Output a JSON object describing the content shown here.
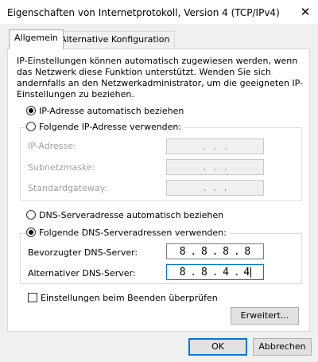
{
  "window": {
    "title": "Eigenschaften von Internetprotokoll, Version 4 (TCP/IPv4)",
    "close_glyph": "✕"
  },
  "tabs": [
    {
      "label": "Allgemein",
      "active": true
    },
    {
      "label": "Alternative Konfiguration",
      "active": false
    }
  ],
  "description": "IP-Einstellungen können automatisch zugewiesen werden, wenn das Netzwerk diese Funktion unterstützt. Wenden Sie sich andernfalls an den Netzwerkadministrator, um die geeigneten IP-Einstellungen zu beziehen.",
  "ip_section": {
    "auto_radio": {
      "text": "IP-Adresse automatisch beziehen",
      "selected": true
    },
    "manual_radio": {
      "text": "Folgende IP-Adresse verwenden:",
      "selected": false
    },
    "fields": [
      {
        "label": "IP-Adresse:",
        "value": ". . ."
      },
      {
        "label": "Subnetzmaske:",
        "value": ". . ."
      },
      {
        "label": "Standardgateway:",
        "value": ". . ."
      }
    ]
  },
  "dns_section": {
    "auto_radio": {
      "text": "DNS-Serveradresse automatisch beziehen",
      "selected": false
    },
    "manual_radio": {
      "text": "Folgende DNS-Serveradressen verwenden:",
      "selected": true
    },
    "preferred": {
      "label": "Bevorzugter DNS-Server:",
      "octets": [
        "8",
        "8",
        "8",
        "8"
      ]
    },
    "alternate": {
      "label": "Alternativer DNS-Server:",
      "octets": [
        "8",
        "8",
        "4",
        "4"
      ]
    }
  },
  "validate_checkbox": {
    "text": "Einstellungen beim Beenden überprüfen",
    "checked": false
  },
  "buttons": {
    "advanced": "Erweitert...",
    "ok": "OK",
    "cancel": "Abbrechen"
  },
  "colors": {
    "accent": "#0078d7",
    "disabled_text": "#a0a0a0",
    "window_bg": "#f0f0f0"
  }
}
